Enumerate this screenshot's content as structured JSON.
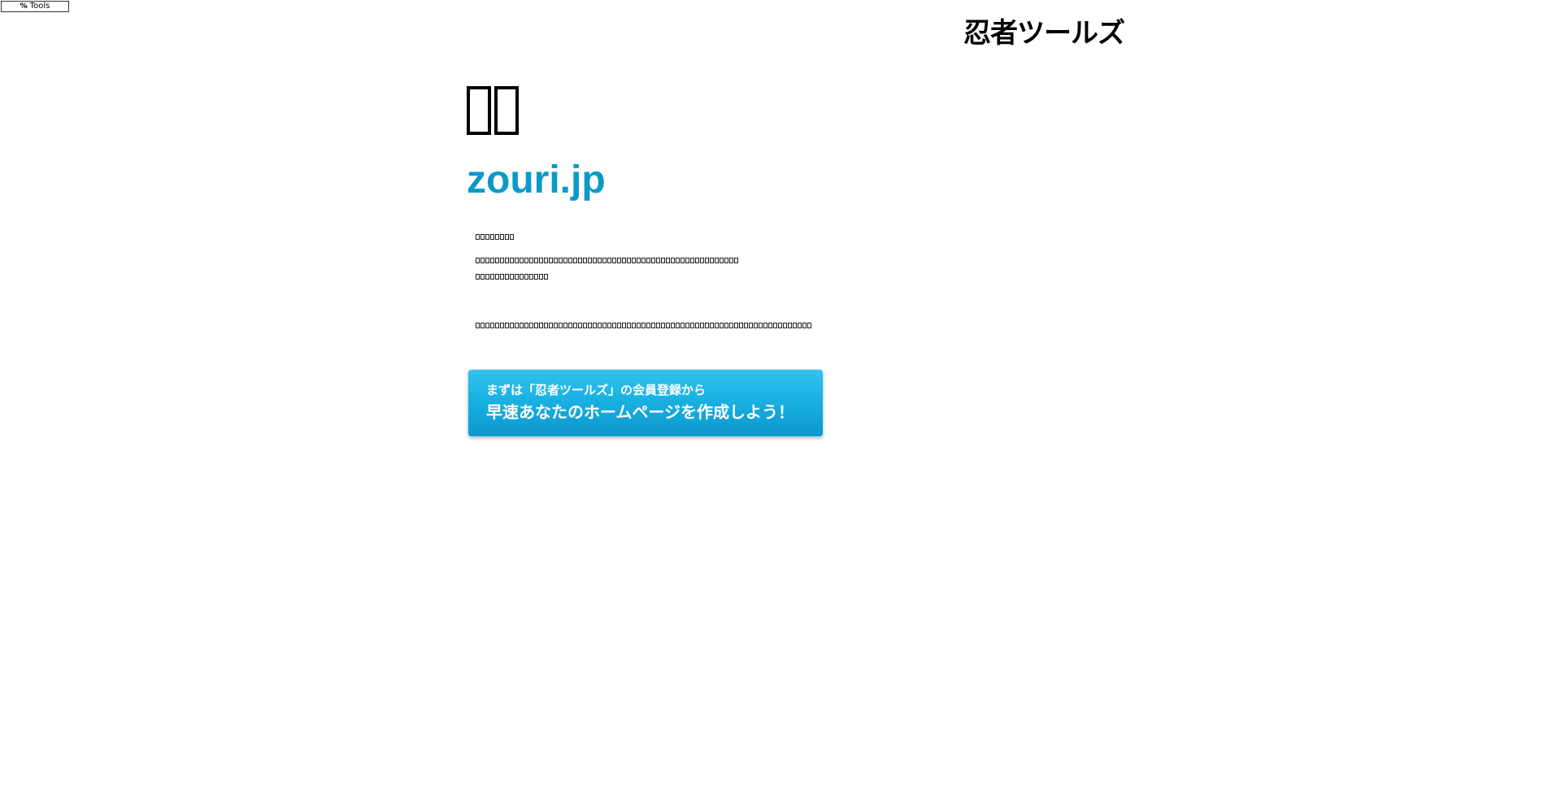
{
  "badge": {
    "label": "Tools",
    "mark": "%"
  },
  "logo": {
    "text": "忍者ツールズ"
  },
  "domain": {
    "name": "zouri.jp"
  },
  "cta": {
    "line1": "まずは「忍者ツールズ」の会員登録から",
    "line2": "早速あなたのホームページを作成しよう！"
  }
}
